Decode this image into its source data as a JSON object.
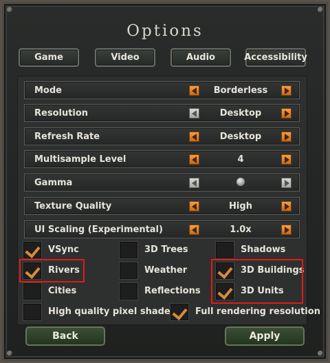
{
  "title": "Options",
  "tabs": [
    {
      "label": "Game"
    },
    {
      "label": "Video"
    },
    {
      "label": "Audio"
    },
    {
      "label": "Accessibility"
    }
  ],
  "settings": [
    {
      "label": "Mode",
      "value": "Borderless",
      "left_enabled": true,
      "right_enabled": true
    },
    {
      "label": "Resolution",
      "value": "Desktop",
      "left_enabled": false,
      "right_enabled": true
    },
    {
      "label": "Refresh Rate",
      "value": "Desktop",
      "left_enabled": true,
      "right_enabled": true
    },
    {
      "label": "Multisample Level",
      "value": "4",
      "left_enabled": true,
      "right_enabled": true
    },
    {
      "label": "Gamma",
      "value": "",
      "slider": true,
      "left_enabled": false,
      "right_enabled": false
    },
    {
      "label": "Texture Quality",
      "value": "High",
      "left_enabled": true,
      "right_enabled": true
    },
    {
      "label": "UI Scaling (Experimental)",
      "value": "1.0x",
      "left_enabled": true,
      "right_enabled": true
    }
  ],
  "checkboxes": {
    "vsync": {
      "label": "VSync",
      "checked": true
    },
    "trees3d": {
      "label": "3D Trees",
      "checked": false
    },
    "shadows": {
      "label": "Shadows",
      "checked": false
    },
    "rivers": {
      "label": "Rivers",
      "checked": true
    },
    "weather": {
      "label": "Weather",
      "checked": false
    },
    "buildings3d": {
      "label": "3D Buildings",
      "checked": true
    },
    "cities": {
      "label": "Cities",
      "checked": false
    },
    "reflections": {
      "label": "Reflections",
      "checked": false
    },
    "units3d": {
      "label": "3D Units",
      "checked": true
    },
    "hq_shaders": {
      "label": "High quality pixel shaders",
      "checked": false
    },
    "full_res": {
      "label": "Full rendering resolution",
      "checked": true
    }
  },
  "buttons": {
    "back": "Back",
    "apply": "Apply"
  },
  "colors": {
    "accent_orange": "#e08a3a",
    "highlight_red": "#e01b1b",
    "button_green": "#34472e"
  }
}
